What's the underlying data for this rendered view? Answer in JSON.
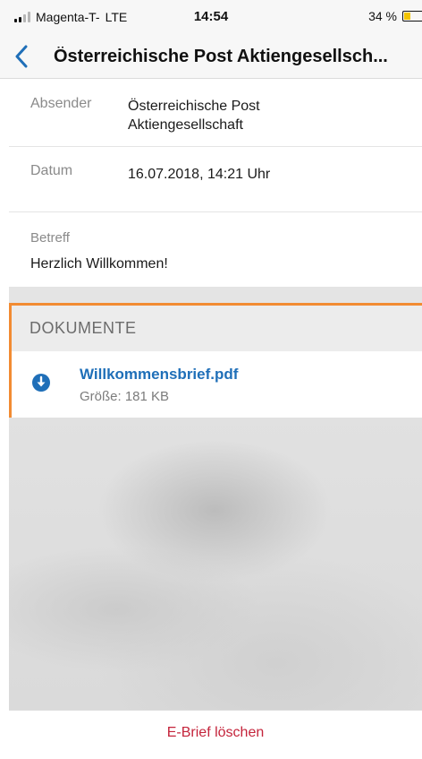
{
  "status_bar": {
    "carrier": "Magenta-T-",
    "network": "LTE",
    "time": "14:54",
    "battery": "34 %",
    "battery_level": 0.34
  },
  "nav": {
    "back_icon": "chevron-left-icon",
    "title": "Österreichische Post Aktiengesellsch..."
  },
  "details": {
    "absender_label": "Absender",
    "absender_line1": "Österreichische Post",
    "absender_line2": "Aktiengesellschaft",
    "datum_label": "Datum",
    "datum_value": "16.07.2018, 14:21 Uhr",
    "betreff_label": "Betreff",
    "betreff_value": "Herzlich Willkommen!"
  },
  "documents": {
    "header": "DOKUMENTE",
    "items": [
      {
        "icon": "download-icon",
        "name": "Willkommensbrief.pdf",
        "size": "Größe: 181 KB"
      }
    ]
  },
  "footer": {
    "delete_label": "E-Brief löschen"
  },
  "colors": {
    "accent": "#1f6fb8",
    "highlight_border": "#f28b32",
    "danger": "#c4243b"
  }
}
